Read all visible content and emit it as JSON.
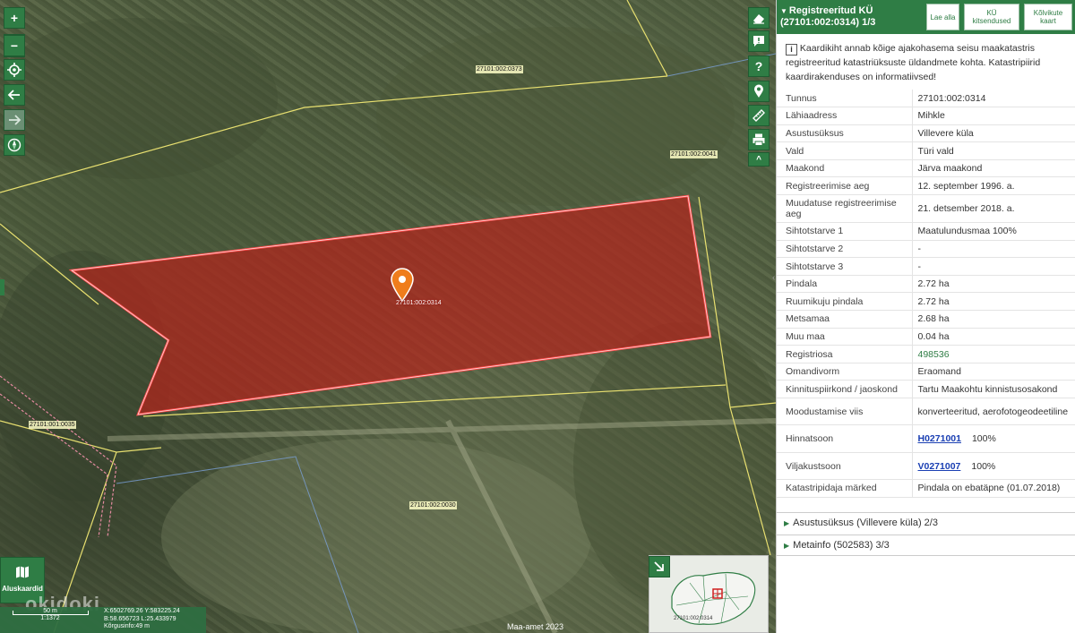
{
  "map": {
    "parcel_labels": {
      "selected": "27101:002:0314",
      "n1": "27101:002:0373",
      "n2": "27101:002:0041",
      "n3": "27101:001:0035",
      "n4": "27101:002:0030"
    },
    "basemap_label": "Aluskaardid",
    "scale": {
      "distance": "50 m",
      "ratio": "1:1372"
    },
    "coords": {
      "xy": "X:6502769.26 Y:583225.24",
      "bl": "B:58.656723 L:25.433979",
      "height": "Kõrgusinfo:49 m"
    },
    "copyright": "Maa-amet 2023",
    "watermark": "okidoki",
    "minimap_label": "27101:002:0314",
    "colors": {
      "parcel_fill": "#b3241c",
      "parcel_stroke": "#ff4a4a",
      "boundary": "#e8e070",
      "ui_green": "#2f7d45"
    }
  },
  "panel": {
    "title_line1": "Registreeritud KÜ",
    "title_line2": "(27101:002:0314) 1/3",
    "buttons": {
      "download": "Lae alla",
      "restrictions": "KÜ kitsendused",
      "suitable_map": "Kõlvikute kaart"
    },
    "notice": "Kaardikiht annab kõige ajakohasema seisu maakatastris registreeritud katastriüksuste üldandmete kohta. Katastripiirid kaardirakenduses on informatiivsed!",
    "rows": [
      {
        "k": "Tunnus",
        "v": "27101:002:0314"
      },
      {
        "k": "Lähiaadress",
        "v": "Mihkle"
      },
      {
        "k": "Asustusüksus",
        "v": "Villevere küla"
      },
      {
        "k": "Vald",
        "v": "Türi vald"
      },
      {
        "k": "Maakond",
        "v": "Järva maakond"
      },
      {
        "k": "Registreerimise aeg",
        "v": "12. september 1996. a."
      },
      {
        "k": "Muudatuse registreerimise aeg",
        "v": "21. detsember 2018. a."
      },
      {
        "k": "Sihtotstarve 1",
        "v": "Maatulundusmaa 100%"
      },
      {
        "k": "Sihtotstarve 2",
        "v": "-"
      },
      {
        "k": "Sihtotstarve 3",
        "v": "-"
      },
      {
        "k": "Pindala",
        "v": "2.72 ha"
      },
      {
        "k": "Ruumikuju pindala",
        "v": "2.72 ha"
      },
      {
        "k": "Metsamaa",
        "v": "2.68 ha"
      },
      {
        "k": "Muu maa",
        "v": "0.04 ha"
      },
      {
        "k": "Registriosa",
        "v": "498536"
      },
      {
        "k": "Omandivorm",
        "v": "Eraomand"
      },
      {
        "k": "Kinnituspiirkond / jaoskond",
        "v": "Tartu Maakohtu kinnistusosakond"
      },
      {
        "k": "Moodustamise viis",
        "v": "konverteeritud, aerofotogeodeetiline"
      },
      {
        "k": "Hinnatsoon",
        "v": "H0271001",
        "v2": "100%"
      },
      {
        "k": "Viljakustsoon",
        "v": "V0271007",
        "v2": "100%"
      },
      {
        "k": "Katastripidaja märked",
        "v": "Pindala on ebatäpne (01.07.2018)"
      }
    ],
    "sections": {
      "settlement": "Asustusüksus (Villevere küla) 2/3",
      "metainfo": "Metainfo (502583) 3/3"
    }
  }
}
